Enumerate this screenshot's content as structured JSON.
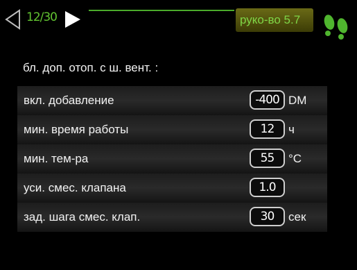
{
  "header": {
    "page_indicator": "12/30",
    "menu_tag": "руко-во 5.7",
    "accent_color": "#4bab2b"
  },
  "section_title": "бл. доп. отоп. с ш. вент. :",
  "rows": [
    {
      "label": "вкл. добавление",
      "value": "-400",
      "unit": "DM"
    },
    {
      "label": "мин. время работы",
      "value": "12",
      "unit": "ч"
    },
    {
      "label": "мин. тем-ра",
      "value": "55",
      "unit": "°C"
    },
    {
      "label": "уси. смес. клапана",
      "value": "1.0",
      "unit": ""
    },
    {
      "label": "зад. шага смес. клап.",
      "value": "30",
      "unit": "сек"
    }
  ]
}
